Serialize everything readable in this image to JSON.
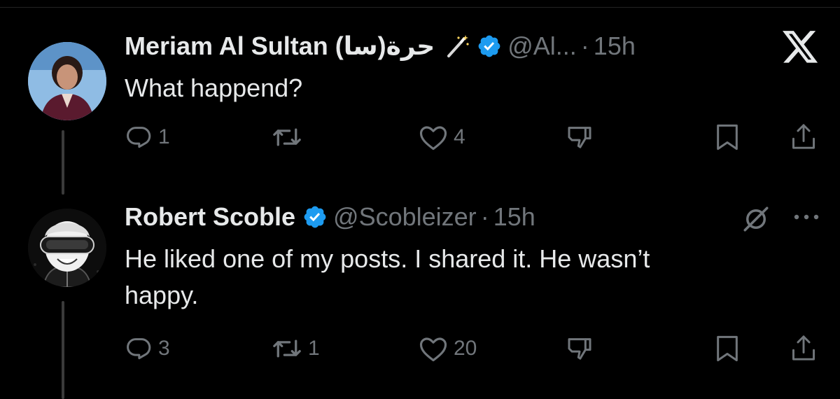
{
  "tweet1": {
    "name": "Meriam Al Sultan (سا)حرة",
    "handle": "@Al...",
    "sep": "·",
    "time": "15h",
    "text": "What happend?",
    "replies": "1",
    "reposts": "",
    "likes": "4"
  },
  "tweet2": {
    "name": "Robert Scoble",
    "handle": "@Scobleizer",
    "sep": "·",
    "time": "15h",
    "text_line1": "He liked one of my posts. I shared it. He wasn’t",
    "text_line2": "happy.",
    "replies": "3",
    "reposts": "1",
    "likes": "20"
  },
  "colors": {
    "background": "#000000",
    "text": "#e7e9ea",
    "muted": "#71767b",
    "verified": "#1d9bf0"
  },
  "icons": {
    "app_logo": "x-logo-icon",
    "verified": "verified-badge-icon",
    "magic": "magic-wand-icon",
    "reply": "reply-icon",
    "repost": "repost-icon",
    "like": "heart-icon",
    "dislike": "dislike-icon",
    "bookmark": "bookmark-icon",
    "share": "share-icon",
    "grok": "grok-icon",
    "more": "more-icon"
  }
}
